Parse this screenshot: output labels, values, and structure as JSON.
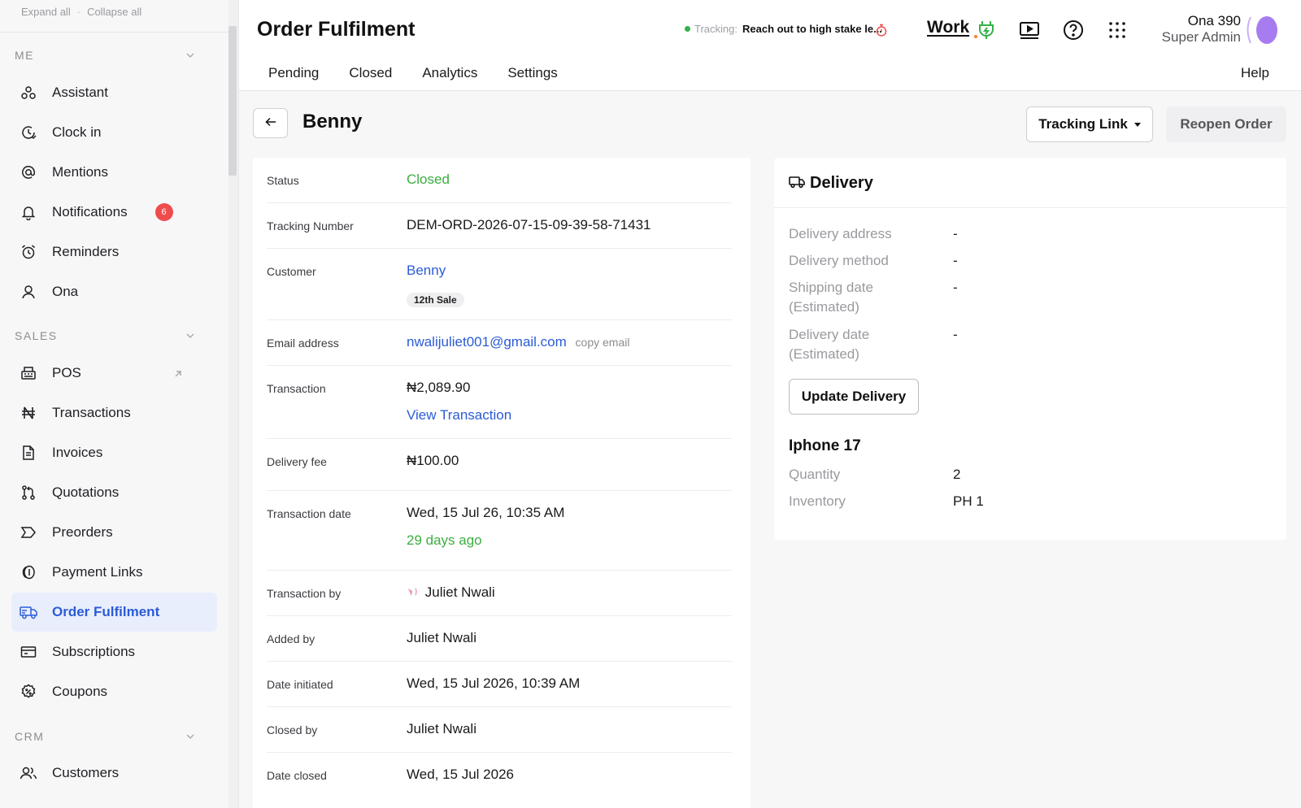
{
  "sidebar": {
    "expand_all": "Expand all",
    "collapse_all": "Collapse all",
    "separator": "·",
    "sections": [
      {
        "title": "ME"
      },
      {
        "title": "SALES"
      },
      {
        "title": "CRM"
      }
    ],
    "items": [
      {
        "label": "Assistant",
        "icon": "assistant-icon"
      },
      {
        "label": "Clock in",
        "icon": "clock-in-icon"
      },
      {
        "label": "Mentions",
        "icon": "at-icon"
      },
      {
        "label": "Notifications",
        "icon": "bell-icon",
        "badge": "6"
      },
      {
        "label": "Reminders",
        "icon": "alarm-icon"
      },
      {
        "label": "Ona",
        "icon": "user-icon"
      },
      {
        "label": "POS",
        "icon": "pos-icon"
      },
      {
        "label": "Transactions",
        "icon": "naira-icon"
      },
      {
        "label": "Invoices",
        "icon": "invoice-icon"
      },
      {
        "label": "Quotations",
        "icon": "quotation-icon"
      },
      {
        "label": "Preorders",
        "icon": "preorder-icon"
      },
      {
        "label": "Payment Links",
        "icon": "payment-link-icon"
      },
      {
        "label": "Order Fulfilment",
        "icon": "truck-icon",
        "active": true
      },
      {
        "label": "Subscriptions",
        "icon": "subscription-icon"
      },
      {
        "label": "Coupons",
        "icon": "coupon-icon"
      },
      {
        "label": "Customers",
        "icon": "customers-icon"
      }
    ]
  },
  "header": {
    "title": "Order Fulfilment",
    "tracking_label": "Tracking:",
    "tracking_text": "Reach out to high stake le...",
    "logo_text": "Work",
    "user_name": "Ona 390",
    "user_role": "Super Admin",
    "tabs": [
      "Pending",
      "Closed",
      "Analytics",
      "Settings"
    ],
    "help": "Help"
  },
  "order": {
    "name": "Benny",
    "tracking_link_label": "Tracking Link",
    "reopen_label": "Reopen Order",
    "fields": {
      "status": {
        "label": "Status",
        "value": "Closed"
      },
      "tracking_number": {
        "label": "Tracking Number",
        "value": "DEM-ORD-2026-07-15-09-39-58-71431"
      },
      "customer": {
        "label": "Customer",
        "value": "Benny",
        "badge": "12th Sale"
      },
      "email": {
        "label": "Email address",
        "value": "nwalijuliet001@gmail.com",
        "copy": "copy email"
      },
      "transaction": {
        "label": "Transaction",
        "value": "₦2,089.90",
        "link": "View Transaction"
      },
      "delivery_fee": {
        "label": "Delivery fee",
        "value": "₦100.00"
      },
      "transaction_date": {
        "label": "Transaction date",
        "value": "Wed, 15 Jul 26, 10:35 AM",
        "relative": "29 days ago"
      },
      "transaction_by": {
        "label": "Transaction by",
        "value": "Juliet Nwali"
      },
      "added_by": {
        "label": "Added by",
        "value": "Juliet Nwali"
      },
      "date_initiated": {
        "label": "Date initiated",
        "value": "Wed, 15 Jul 2026, 10:39 AM"
      },
      "closed_by": {
        "label": "Closed by",
        "value": "Juliet Nwali"
      },
      "date_closed": {
        "label": "Date closed",
        "value": "Wed, 15 Jul 2026"
      }
    }
  },
  "delivery": {
    "title": "Delivery",
    "address": {
      "label": "Delivery address",
      "value": "-"
    },
    "method": {
      "label": "Delivery method",
      "value": "-"
    },
    "shipping_date": {
      "label_1": "Shipping date",
      "label_2": "(Estimated)",
      "value": "-"
    },
    "delivery_date": {
      "label_1": "Delivery date",
      "label_2": "(Estimated)",
      "value": "-"
    },
    "update_label": "Update Delivery",
    "product": {
      "title": "Iphone 17",
      "quantity_label": "Quantity",
      "quantity": "2",
      "inventory_label": "Inventory",
      "inventory": "PH 1"
    }
  },
  "colors": {
    "accent_blue": "#2a5bd7",
    "success_green": "#3cae3f",
    "badge_red": "#ef4d4d",
    "avatar_purple": "#a77cf0"
  }
}
